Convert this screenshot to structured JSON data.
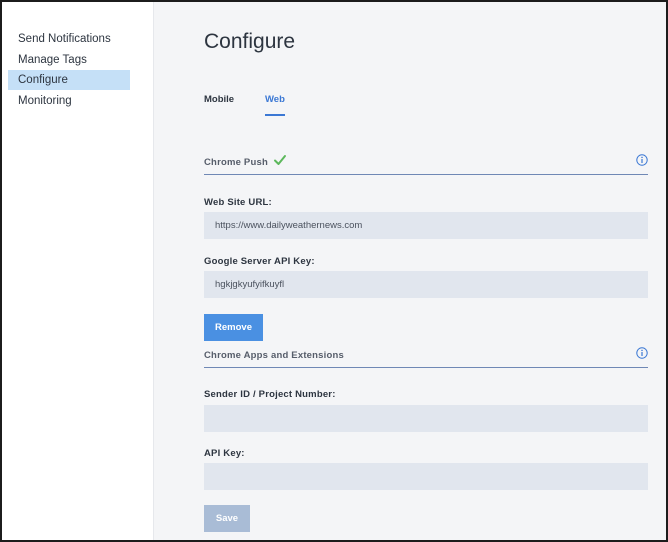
{
  "sidebar": {
    "items": [
      {
        "label": "Send Notifications"
      },
      {
        "label": "Manage Tags"
      },
      {
        "label": "Configure"
      },
      {
        "label": "Monitoring"
      }
    ]
  },
  "main": {
    "title": "Configure",
    "tabs": [
      {
        "label": "Mobile"
      },
      {
        "label": "Web"
      }
    ],
    "chrome_push": {
      "title": "Chrome Push",
      "status_icon": "check-icon",
      "website_url_label": "Web Site URL:",
      "website_url_value": "https://www.dailyweathernews.com",
      "api_key_label": "Google Server API Key:",
      "api_key_value": "hgkjgkyufyifkuyfl",
      "remove_label": "Remove"
    },
    "chrome_apps": {
      "title": "Chrome Apps and Extensions",
      "sender_id_label": "Sender ID / Project Number:",
      "sender_id_value": "",
      "api_key_label": "API Key:",
      "api_key_value": "",
      "save_label": "Save"
    }
  },
  "colors": {
    "accent": "#4a90e2",
    "tab_active": "#3b78d4",
    "nav_active_bg": "#c5e0f7",
    "input_bg": "#e1e6ee",
    "success": "#5cb85c",
    "save_disabled": "#a9bcd6"
  }
}
